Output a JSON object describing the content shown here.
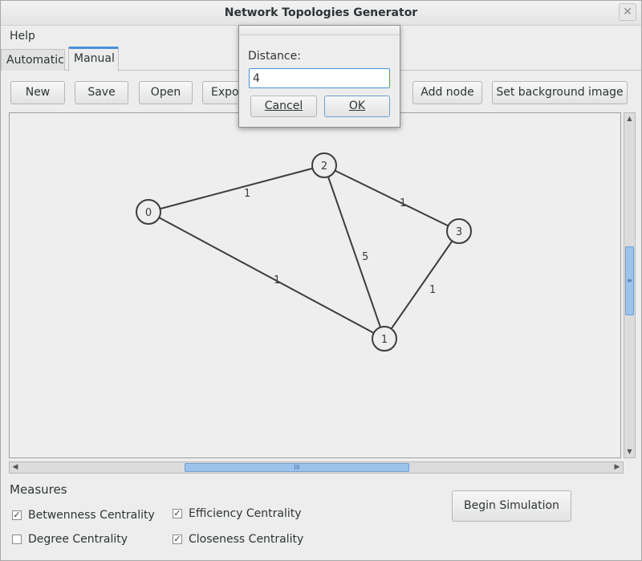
{
  "window": {
    "title": "Network Topologies Generator",
    "close_glyph": "✕"
  },
  "menu": {
    "help": "Help"
  },
  "tabs": [
    {
      "label": "Automatic"
    },
    {
      "label": "Manual"
    }
  ],
  "toolbar": {
    "new_label": "New",
    "save_label": "Save",
    "open_label": "Open",
    "export_label": "Export",
    "add_node_label": "Add node",
    "set_bg_label": "Set background image"
  },
  "graph": {
    "nodes": [
      {
        "id": "0",
        "label": "0"
      },
      {
        "id": "1",
        "label": "1"
      },
      {
        "id": "2",
        "label": "2"
      },
      {
        "id": "3",
        "label": "3"
      }
    ],
    "edges": [
      {
        "from": "0",
        "to": "2",
        "weight": "1"
      },
      {
        "from": "2",
        "to": "3",
        "weight": "1"
      },
      {
        "from": "2",
        "to": "1",
        "weight": "5"
      },
      {
        "from": "0",
        "to": "1",
        "weight": "1"
      },
      {
        "from": "3",
        "to": "1",
        "weight": "1"
      }
    ]
  },
  "scroll": {
    "up": "▲",
    "down": "▼",
    "left": "◀",
    "right": "▶",
    "v_grip": "≡",
    "h_grip": "III"
  },
  "measures": {
    "title": "Measures",
    "betweenness": {
      "label": "Betwenness Centrality",
      "checked": true
    },
    "degree": {
      "label": "Degree Centrality",
      "checked": false
    },
    "efficiency": {
      "label": "Efficiency Centrality",
      "checked": true
    },
    "closeness": {
      "label": "Closeness Centrality",
      "checked": true
    },
    "check_mark": "✓"
  },
  "simulation": {
    "begin_label": "Begin Simulation"
  },
  "dialog": {
    "label": "Distance:",
    "value": "4",
    "cancel_label": "Cancel",
    "ok_label": "OK"
  }
}
